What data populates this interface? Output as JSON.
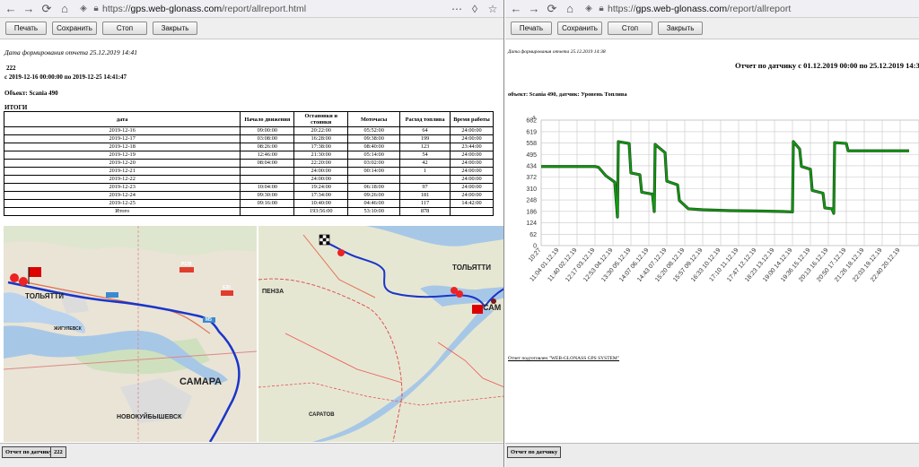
{
  "left": {
    "address": {
      "scheme": "https://",
      "host": "gps.web-glonass.com",
      "path": "/report/allreport.html"
    },
    "toolbar": {
      "print": "Печать",
      "save": "Сохранить",
      "stop": "Стоп",
      "close": "Закрыть"
    },
    "stamp": "Дата формирования отчета 25.12.2019 14:41",
    "report_id": "222",
    "period": "с 2019-12-16 00:00:00 по 2019-12-25 14:41:47",
    "object": "Объект: Scania 490",
    "totals_heading": "ИТОГИ",
    "table": {
      "headers": [
        "дата",
        "Начало движения",
        "Остановки и стоянки",
        "Моточасы",
        "Расход топлива",
        "Время работы"
      ],
      "rows": [
        [
          "2019-12-16",
          "09:00:00",
          "20:22:00",
          "05:52:00",
          "64",
          "24:00:00"
        ],
        [
          "2019-12-17",
          "03:08:00",
          "16:28:00",
          "09:38:00",
          "199",
          "24:00:00"
        ],
        [
          "2019-12-18",
          "08:26:00",
          "17:38:00",
          "08:40:00",
          "123",
          "23:44:00"
        ],
        [
          "2019-12-19",
          "12:46:00",
          "21:30:00",
          "05:14:00",
          "54",
          "24:00:00"
        ],
        [
          "2019-12-20",
          "08:04:00",
          "22:20:00",
          "03:02:00",
          "42",
          "24:00:00"
        ],
        [
          "2019-12-21",
          "",
          "24:00:00",
          "00:14:00",
          "1",
          "24:00:00"
        ],
        [
          "2019-12-22",
          "",
          "24:00:00",
          "",
          "",
          "24:00:00"
        ],
        [
          "2019-12-23",
          "10:04:00",
          "19:24:00",
          "06:18:00",
          "97",
          "24:00:00"
        ],
        [
          "2019-12-24",
          "09:30:00",
          "17:34:00",
          "09:26:00",
          "181",
          "24:00:00"
        ],
        [
          "2019-12-25",
          "09:16:00",
          "10:40:00",
          "04:46:00",
          "117",
          "14:42:00"
        ],
        [
          "Итого",
          "",
          "193:56:00",
          "53:10:00",
          "878",
          ""
        ]
      ]
    },
    "map": {
      "tolyatti": "ТОЛЬЯТТИ",
      "zhigulevsk": "ЖИГУЛЕВСК",
      "samara": "САМАРА",
      "novokuybyshevsk": "НОВОКУЙБЫШЕВСК",
      "penza": "ПЕНЗА",
      "saratov": "САРАТОВ",
      "tolyatti2": "ТОЛЬЯТТИ",
      "sam": "САМ",
      "road_r176": "Р176",
      "road_m5": "М5",
      "road_e30": "Е30"
    },
    "bottom_tab": "Отчет по датчику",
    "bottom_id": "222"
  },
  "right": {
    "address": {
      "scheme": "https://",
      "host": "gps.web-glonass.com",
      "path": "/report/allreport"
    },
    "toolbar": {
      "print": "Печать",
      "save": "Сохранить",
      "stop": "Стоп",
      "close": "Закрыть"
    },
    "stamp": "Дата формирования отчета 25.12.2019 14:38",
    "title": "Отчет по датчику с 01.12.2019 00:00 по 25.12.2019 14:38",
    "subject": "объект: Scania 490, датчик: Уровень Топлива",
    "footer": "Отчет подготовлен \"WEB-GLONASS GPS SYSTEM\"",
    "bottom_tab": "Отчет по датчику"
  },
  "chart_data": {
    "type": "line",
    "title": "Отчет по датчику с 01.12.2019 00:00 по 25.12.2019 14:38",
    "ylabel": "л.",
    "xlabel": "",
    "ylim": [
      0,
      682
    ],
    "yticks": [
      0,
      62,
      124,
      186,
      248,
      310,
      372,
      434,
      495,
      558,
      619,
      682
    ],
    "xticks": [
      "10:27",
      "11:04 01.12.19",
      "11:40 02.12.19",
      "12:17 03.12.19",
      "12:53 04.12.19",
      "13:30 05.12.19",
      "14:07 06.12.19",
      "14:43 07.12.19",
      "15:20 08.12.19",
      "15:57 09.12.19",
      "16:33 10.12.19",
      "17:10 11.12.19",
      "17:47 12.12.19",
      "18:23 13.12.19",
      "19:00 14.12.19",
      "19:36 15.12.19",
      "20:13 16.12.19",
      "20:50 17.12.19",
      "21:26 18.12.19",
      "22:03 19.12.19",
      "22:40 20.12.19"
    ],
    "grid": true,
    "legend": "none",
    "series_color": "#0aa10a",
    "series": [
      {
        "values": [
          [
            0,
            430
          ],
          [
            3.0,
            430
          ],
          [
            3.2,
            425
          ],
          [
            3.6,
            380
          ],
          [
            4.1,
            345
          ],
          [
            4.25,
            155
          ],
          [
            4.3,
            565
          ],
          [
            4.9,
            555
          ],
          [
            5.0,
            395
          ],
          [
            5.5,
            385
          ],
          [
            5.6,
            290
          ],
          [
            6.2,
            280
          ],
          [
            6.3,
            185
          ],
          [
            6.35,
            550
          ],
          [
            6.9,
            505
          ],
          [
            7.0,
            350
          ],
          [
            7.6,
            330
          ],
          [
            7.7,
            245
          ],
          [
            8.2,
            200
          ],
          [
            9.0,
            195
          ],
          [
            10.5,
            190
          ],
          [
            12.0,
            188
          ],
          [
            13.5,
            185
          ],
          [
            14.0,
            183
          ],
          [
            14.05,
            565
          ],
          [
            14.4,
            525
          ],
          [
            14.5,
            430
          ],
          [
            15.0,
            415
          ],
          [
            15.1,
            300
          ],
          [
            15.7,
            285
          ],
          [
            15.8,
            205
          ],
          [
            16.2,
            200
          ],
          [
            16.3,
            175
          ],
          [
            16.35,
            560
          ],
          [
            17.0,
            555
          ],
          [
            17.1,
            515
          ],
          [
            20.5,
            515
          ]
        ]
      }
    ]
  }
}
